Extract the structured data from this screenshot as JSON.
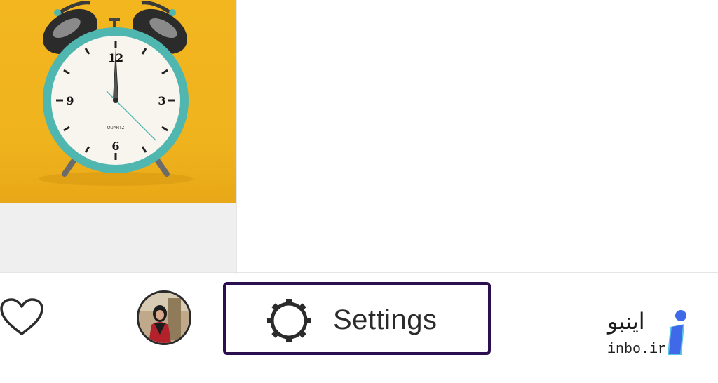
{
  "toolbar": {
    "settings_label": "Settings"
  },
  "watermark": {
    "name_fa": "اینبو",
    "url": "inbo.ir"
  },
  "thumbnail": {
    "clock_label": "QUARTZ",
    "numerals": [
      "12",
      "3",
      "6",
      "9"
    ]
  },
  "icons": {
    "like": "heart-outline-icon",
    "settings": "gear-outline-icon",
    "brand": "inbo-logo-icon"
  },
  "colors": {
    "highlight_border": "#2c0f4f",
    "thumbnail_bg": "#f3b61f",
    "clock_rim": "#4fb7b0",
    "logo_blue": "#3f69e8"
  }
}
